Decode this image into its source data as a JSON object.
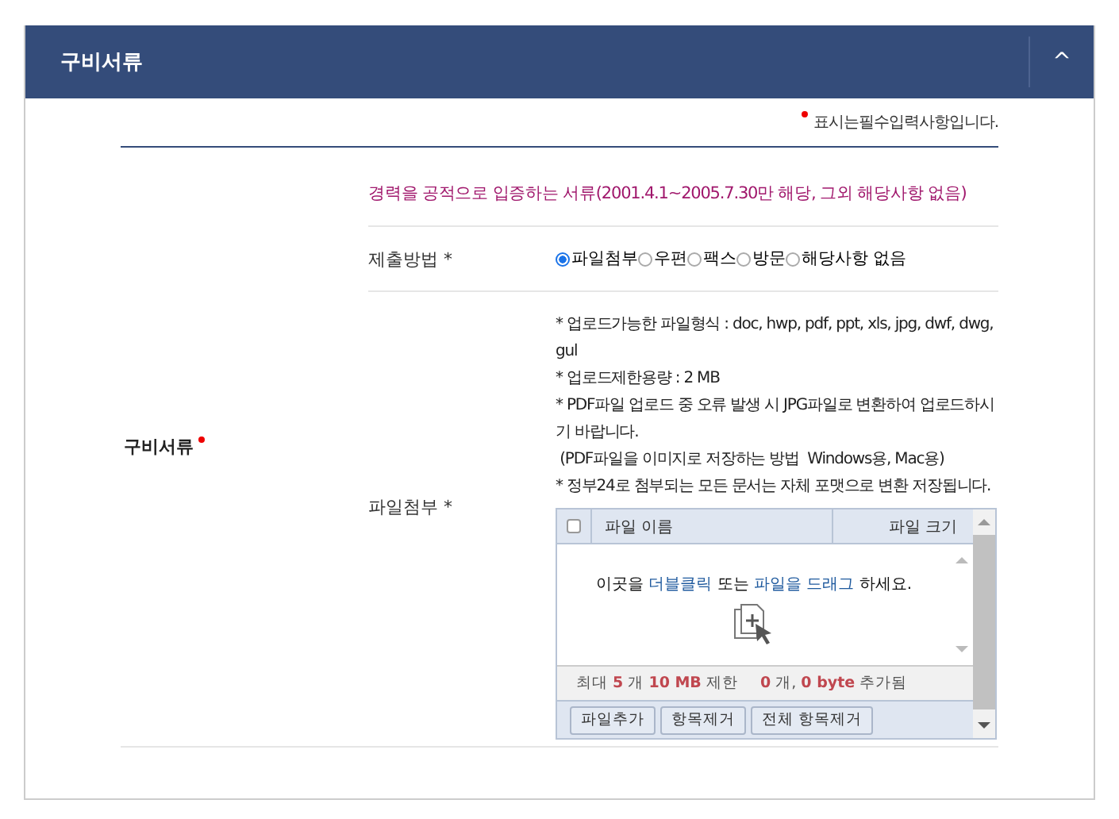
{
  "panel": {
    "title": "구비서류",
    "collapse_icon": "^"
  },
  "required_note": "표시는필수입력사항입니다.",
  "section": {
    "label": "구비서류",
    "required": true,
    "notice": "경력을 공적으로 입증하는 서류(2001.4.1~2005.7.30만 해당, 그외 해당사항 없음)",
    "method": {
      "label": "제출방법 *",
      "options": [
        {
          "label": "파일첨부",
          "selected": true
        },
        {
          "label": "우편",
          "selected": false
        },
        {
          "label": "팩스",
          "selected": false
        },
        {
          "label": "방문",
          "selected": false
        },
        {
          "label": "해당사항 없음",
          "selected": false
        }
      ]
    },
    "attach": {
      "label": "파일첨부 *",
      "info": [
        "* 업로드가능한 파일형식 : doc, hwp, pdf, ppt, xls, jpg, dwf, dwg, gul",
        "* 업로드제한용량 : 2 MB",
        "* PDF파일 업로드 중 오류 발생 시 JPG파일로 변환하여 업로드하시기 바랍니다.",
        " (PDF파일을 이미지로 저장하는 방법  Windows용, Mac용)",
        "* 정부24로 첨부되는 모든 문서는 자체 포맷으로 변환 저장됩니다."
      ],
      "uploader": {
        "checked": false,
        "columns": [
          "파일 이름",
          "파일 크기"
        ],
        "drop_text": [
          {
            "text": "이곳을 ",
            "link": false
          },
          {
            "text": "더블클릭",
            "link": true
          },
          {
            "text": " 또는 ",
            "link": false
          },
          {
            "text": "파일을 드래그",
            "link": true
          },
          {
            "text": " 하세요.",
            "link": false
          }
        ],
        "status": [
          {
            "text": "최대 ",
            "highlight": false
          },
          {
            "text": "5",
            "highlight": true
          },
          {
            "text": " 개 ",
            "highlight": false
          },
          {
            "text": "10 MB",
            "highlight": true
          },
          {
            "text": " 제한",
            "highlight": false
          },
          {
            "text": "0",
            "highlight": true
          },
          {
            "text": " 개, ",
            "highlight": false
          },
          {
            "text": "0 byte",
            "highlight": true
          },
          {
            "text": " 추가됨",
            "highlight": false
          }
        ],
        "buttons": [
          "파일추가",
          "항목제거",
          "전체 항목제거"
        ]
      }
    }
  }
}
